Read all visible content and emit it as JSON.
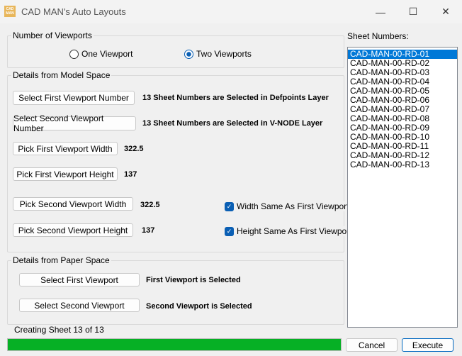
{
  "window": {
    "title": "CAD MAN's Auto Layouts",
    "logo_text": "CAD MAN",
    "minimize": "—",
    "maximize": "☐",
    "close": "✕"
  },
  "viewports": {
    "legend": "Number of Viewports",
    "one": "One Viewport",
    "two": "Two Viewports",
    "selected": "two"
  },
  "model": {
    "legend": "Details from Model Space",
    "select_first_btn": "Select First Viewport Number",
    "select_first_status": "13 Sheet Numbers are Selected in Defpoints Layer",
    "select_second_btn": "Select Second Viewport Number",
    "select_second_status": "13 Sheet Numbers are Selected in V-NODE Layer",
    "pick_first_width_btn": "Pick First Viewport Width",
    "first_width": "322.5",
    "pick_first_height_btn": "Pick First Viewport Height",
    "first_height": "137",
    "pick_second_width_btn": "Pick Second Viewport Width",
    "second_width": "322.5",
    "pick_second_height_btn": "Pick Second Viewport Height",
    "second_height": "137",
    "width_same": "Width Same As First Viewport",
    "height_same": "Height Same As First Viewport",
    "width_same_checked": true,
    "height_same_checked": true
  },
  "paper": {
    "legend": "Details from Paper Space",
    "select_first_btn": "Select First Viewport",
    "first_status": "First Viewport is Selected",
    "select_second_btn": "Select Second Viewport",
    "second_status": "Second Viewport is Selected"
  },
  "sheets": {
    "label": "Sheet Numbers:",
    "items": [
      "CAD-MAN-00-RD-01",
      "CAD-MAN-00-RD-02",
      "CAD-MAN-00-RD-03",
      "CAD-MAN-00-RD-04",
      "CAD-MAN-00-RD-05",
      "CAD-MAN-00-RD-06",
      "CAD-MAN-00-RD-07",
      "CAD-MAN-00-RD-08",
      "CAD-MAN-00-RD-09",
      "CAD-MAN-00-RD-10",
      "CAD-MAN-00-RD-11",
      "CAD-MAN-00-RD-12",
      "CAD-MAN-00-RD-13"
    ],
    "selected_index": 0
  },
  "status": {
    "text": "Creating Sheet 13 of 13",
    "progress_percent": 100,
    "progress_color": "#06b025"
  },
  "actions": {
    "cancel": "Cancel",
    "execute": "Execute"
  }
}
